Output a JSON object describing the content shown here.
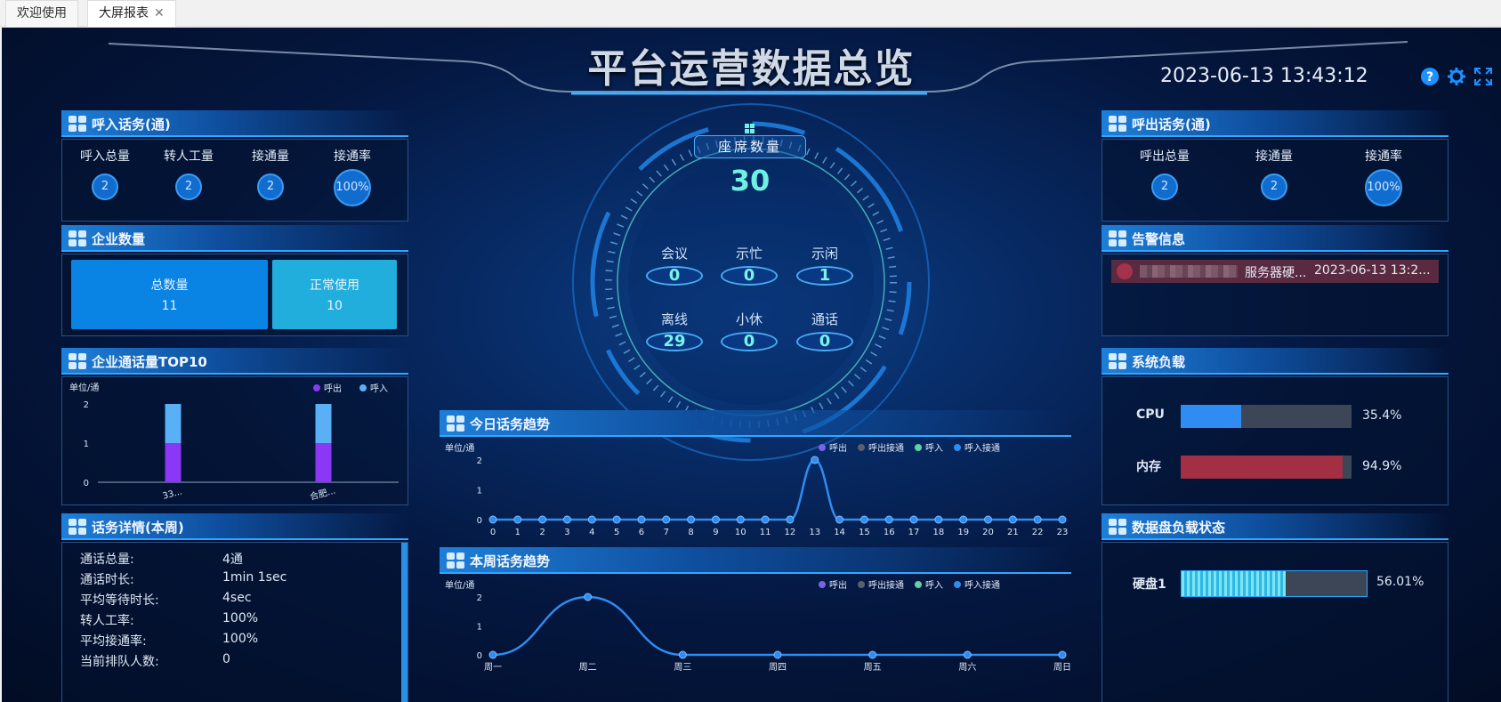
{
  "tabs": [
    {
      "label": "欢迎使用",
      "active": false
    },
    {
      "label": "大屏报表",
      "active": true,
      "close": "✕"
    }
  ],
  "title": "平台运营数据总览",
  "datetime": "2023-06-13 13:43:12",
  "toolbar": {
    "help_icon": "?",
    "settings_icon": "gear",
    "fullscreen_icon": "expand"
  },
  "inbound": {
    "title": "呼入话务(通)",
    "stats": [
      {
        "label": "呼入总量",
        "value": "2"
      },
      {
        "label": "转人工量",
        "value": "2"
      },
      {
        "label": "接通量",
        "value": "2"
      },
      {
        "label": "接通率",
        "value": "100%"
      }
    ]
  },
  "enterprise": {
    "title": "企业数量",
    "total_label": "总数量",
    "total_value": "11",
    "normal_label": "正常使用",
    "normal_value": "10"
  },
  "top10": {
    "title": "企业通话量TOP10",
    "unit": "单位/通",
    "legend": [
      "呼出",
      "呼入"
    ],
    "chart_data": {
      "type": "bar",
      "categories": [
        "33...",
        "合肥..."
      ],
      "series": [
        {
          "name": "呼出",
          "values": [
            1,
            1
          ]
        },
        {
          "name": "呼入",
          "values": [
            1,
            1
          ]
        }
      ],
      "stacked": true,
      "ylim": [
        0,
        2
      ],
      "yticks": [
        "0",
        "1",
        "2"
      ],
      "colors": [
        "#8a38f5",
        "#5ab0f5"
      ]
    }
  },
  "detail": {
    "title": "话务详情(本周)",
    "rows": [
      {
        "label": "通话总量:",
        "value": "4通"
      },
      {
        "label": "通话时长:",
        "value": "1min 1sec"
      },
      {
        "label": "平均等待时长:",
        "value": "4sec"
      },
      {
        "label": "转人工率:",
        "value": "100%"
      },
      {
        "label": "平均接通率:",
        "value": "100%"
      },
      {
        "label": "当前排队人数:",
        "value": "0"
      }
    ]
  },
  "seats": {
    "label": "座席数量",
    "total": "30",
    "items": [
      {
        "label": "会议",
        "value": "0"
      },
      {
        "label": "示忙",
        "value": "0"
      },
      {
        "label": "示闲",
        "value": "1"
      },
      {
        "label": "离线",
        "value": "29"
      },
      {
        "label": "小休",
        "value": "0"
      },
      {
        "label": "通话",
        "value": "0"
      }
    ]
  },
  "today": {
    "title": "今日话务趋势",
    "unit": "单位/通",
    "legend": [
      {
        "name": "呼出",
        "color": "#7a62e8"
      },
      {
        "name": "呼出接通",
        "color": "#5b5f6a"
      },
      {
        "name": "呼入",
        "color": "#5fd3a1"
      },
      {
        "name": "呼入接通",
        "color": "#2f8cf0"
      }
    ],
    "chart_data": {
      "type": "line",
      "x": [
        "0",
        "1",
        "2",
        "3",
        "4",
        "5",
        "6",
        "7",
        "8",
        "9",
        "10",
        "11",
        "12",
        "13",
        "14",
        "15",
        "16",
        "17",
        "18",
        "19",
        "20",
        "21",
        "22",
        "23"
      ],
      "series": [
        {
          "name": "呼入接通",
          "values": [
            0,
            0,
            0,
            0,
            0,
            0,
            0,
            0,
            0,
            0,
            0,
            0,
            0,
            2,
            0,
            0,
            0,
            0,
            0,
            0,
            0,
            0,
            0,
            0
          ]
        }
      ],
      "ylim": [
        0,
        2
      ],
      "yticks": [
        "0",
        "1",
        "2"
      ]
    }
  },
  "week": {
    "title": "本周话务趋势",
    "unit": "单位/通",
    "legend": [
      {
        "name": "呼出",
        "color": "#7a62e8"
      },
      {
        "name": "呼出接通",
        "color": "#5b5f6a"
      },
      {
        "name": "呼入",
        "color": "#5fd3a1"
      },
      {
        "name": "呼入接通",
        "color": "#2f8cf0"
      }
    ],
    "chart_data": {
      "type": "line",
      "x": [
        "周一",
        "周二",
        "周三",
        "周四",
        "周五",
        "周六",
        "周日"
      ],
      "series": [
        {
          "name": "呼入接通",
          "values": [
            0,
            2,
            0,
            0,
            0,
            0,
            0
          ]
        }
      ],
      "ylim": [
        0,
        2
      ],
      "yticks": [
        "0",
        "1",
        "2"
      ]
    }
  },
  "outbound": {
    "title": "呼出话务(通)",
    "stats": [
      {
        "label": "呼出总量",
        "value": "2"
      },
      {
        "label": "接通量",
        "value": "2"
      },
      {
        "label": "接通率",
        "value": "100%"
      }
    ]
  },
  "alarm": {
    "title": "告警信息",
    "items": [
      {
        "text": "服务器硬...",
        "time": "2023-06-13 13:2..."
      }
    ]
  },
  "load": {
    "title": "系统负载",
    "items": [
      {
        "label": "CPU",
        "value": "35.4%",
        "fraction": 0.354,
        "color": "#2e8cf2"
      },
      {
        "label": "内存",
        "value": "94.9%",
        "fraction": 0.949,
        "color": "#a32f44"
      }
    ]
  },
  "disk": {
    "title": "数据盘负载状态",
    "items": [
      {
        "label": "硬盘1",
        "value": "56.01%",
        "fraction": 0.5601
      }
    ]
  }
}
